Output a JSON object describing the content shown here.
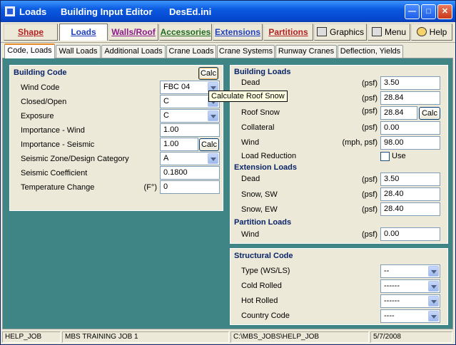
{
  "titlebar": {
    "app": "Loads",
    "editor": "Building Input Editor",
    "file": "DesEd.ini"
  },
  "colors": {
    "shape": "#b22222",
    "walls_roof": "#8b1a8b",
    "accessories": "#1f6b1f",
    "extensions": "#1f3fbf",
    "partitions": "#b22222",
    "panel_title": "#0a246a",
    "content_bg": "#3f8586",
    "tab_highlight": "#e68b2c"
  },
  "toolbar": {
    "shape": "Shape",
    "loads": "Loads",
    "walls_roof": "Walls/Roof",
    "accessories": "Accessories",
    "extensions": "Extensions",
    "partitions": "Partitions",
    "graphics": "Graphics",
    "menu": "Menu",
    "help": "Help"
  },
  "tabs": [
    "Code, Loads",
    "Wall Loads",
    "Additional Loads",
    "Crane Loads",
    "Crane Systems",
    "Runway Cranes",
    "Deflection, Yields"
  ],
  "building_code": {
    "title": "Building Code",
    "calc_label": "Calc",
    "wind_code": {
      "label": "Wind Code",
      "value": "FBC  04"
    },
    "closed_open": {
      "label": "Closed/Open",
      "value": "C"
    },
    "exposure": {
      "label": "Exposure",
      "value": "C"
    },
    "importance_wind": {
      "label": "Importance - Wind",
      "value": "1.00"
    },
    "importance_seismic": {
      "label": "Importance - Seismic",
      "value": "1.00",
      "calc": "Calc"
    },
    "seismic_zone": {
      "label": "Seismic Zone/Design Category",
      "value": "A"
    },
    "seismic_coefficient": {
      "label": "Seismic Coefficient",
      "value": "0.1800"
    },
    "temperature_change": {
      "label": "Temperature Change",
      "unit": "(F°)",
      "value": "0"
    }
  },
  "tooltip": "Calculate Roof Snow",
  "building_loads": {
    "title": "Building Loads",
    "dead": {
      "label": "Dead",
      "unit": "(psf)",
      "value": "3.50"
    },
    "snow": {
      "unit": "(psf)",
      "value": "28.84"
    },
    "roof_snow": {
      "label": "Roof Snow",
      "unit": "(psf)",
      "value": "28.84",
      "calc": "Calc"
    },
    "collateral": {
      "label": "Collateral",
      "unit": "(psf)",
      "value": "0.00"
    },
    "wind": {
      "label": "Wind",
      "unit": "(mph, psf)",
      "value": "98.00"
    },
    "load_reduction": {
      "label": "Load Reduction",
      "check_label": "Use"
    }
  },
  "extension_loads": {
    "title": "Extension Loads",
    "dead": {
      "label": "Dead",
      "unit": "(psf)",
      "value": "3.50"
    },
    "snow_sw": {
      "label": "Snow, SW",
      "unit": "(psf)",
      "value": "28.40"
    },
    "snow_ew": {
      "label": "Snow, EW",
      "unit": "(psf)",
      "value": "28.40"
    }
  },
  "partition_loads": {
    "title": "Partition Loads",
    "wind": {
      "label": "Wind",
      "unit": "(psf)",
      "value": "0.00"
    }
  },
  "structural_code": {
    "title": "Structural Code",
    "type": {
      "label": "Type (WS/LS)",
      "value": "--"
    },
    "cold_rolled": {
      "label": "Cold Rolled",
      "value": "------"
    },
    "hot_rolled": {
      "label": "Hot Rolled",
      "value": "------"
    },
    "country_code": {
      "label": "Country Code",
      "value": "----"
    }
  },
  "status": [
    "HELP_JOB",
    "MBS TRAINING JOB 1",
    "C:\\MBS_JOBS\\HELP_JOB",
    "5/7/2008"
  ]
}
